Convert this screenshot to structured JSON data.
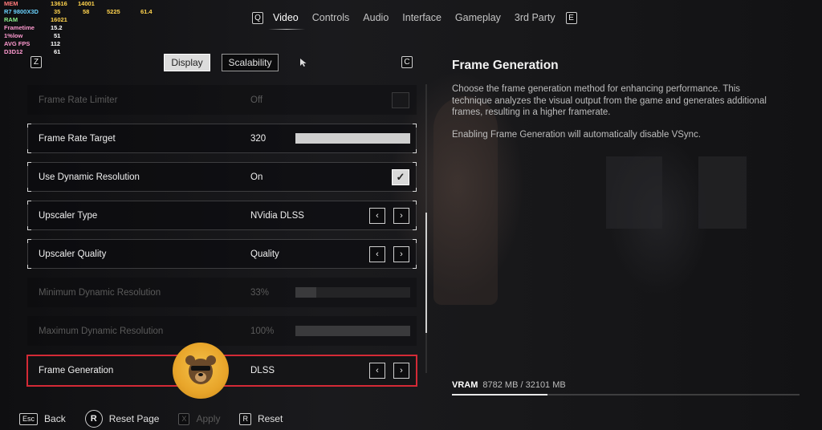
{
  "overlay": {
    "rows": [
      {
        "label": "MEM",
        "values": [
          "13616",
          "14001"
        ]
      },
      {
        "label": "R7 9800X3D",
        "values": [
          "35",
          "58",
          "5225",
          "61.4"
        ]
      },
      {
        "label": "RAM",
        "values": [
          "16021"
        ]
      },
      {
        "label": "Frametime",
        "values": [
          "15.2"
        ]
      },
      {
        "label": "1%low",
        "values": [
          "51"
        ]
      },
      {
        "label": "AVG FPS",
        "values": [
          "112"
        ]
      },
      {
        "label": "D3D12",
        "values": [
          "61"
        ]
      }
    ]
  },
  "topnav": {
    "prev_key": "Q",
    "next_key": "E",
    "tabs": [
      "Video",
      "Controls",
      "Audio",
      "Interface",
      "Gameplay",
      "3rd Party"
    ],
    "active_tab": "Video"
  },
  "subtabs": {
    "prev_key": "Z",
    "next_key": "C",
    "items": [
      "Display",
      "Scalability"
    ],
    "active": "Display"
  },
  "settings": [
    {
      "name": "Frame Rate Limiter",
      "value": "Off",
      "control": "checkbox",
      "checked": false,
      "enabled": false
    },
    {
      "name": "Frame Rate Target",
      "value": "320",
      "control": "slider",
      "level": 1.0,
      "enabled": true
    },
    {
      "name": "Use Dynamic Resolution",
      "value": "On",
      "control": "checkbox",
      "checked": true,
      "enabled": true
    },
    {
      "name": "Upscaler Type",
      "value": "NVidia DLSS",
      "control": "arrows",
      "enabled": true
    },
    {
      "name": "Upscaler Quality",
      "value": "Quality",
      "control": "arrows",
      "enabled": true
    },
    {
      "name": "Minimum Dynamic Resolution",
      "value": "33%",
      "control": "slider",
      "level": 0.18,
      "enabled": false
    },
    {
      "name": "Maximum Dynamic Resolution",
      "value": "100%",
      "control": "slider",
      "level": 1.0,
      "enabled": false
    },
    {
      "name": "Frame Generation",
      "value": "DLSS",
      "control": "arrows",
      "enabled": true,
      "selected": true
    }
  ],
  "info": {
    "title": "Frame Generation",
    "paragraph1": "Choose the frame generation method for enhancing performance. This technique analyzes the visual output from the game and generates additional frames, resulting in a higher framerate.",
    "paragraph2": "Enabling Frame Generation will automatically disable VSync."
  },
  "vram": {
    "label": "VRAM",
    "value": "8782 MB / 32101 MB",
    "used_fraction": 0.274
  },
  "bottom_hints": [
    {
      "key": "Esc",
      "label": "Back",
      "round": false,
      "enabled": true
    },
    {
      "key": "R",
      "label": "Reset Page",
      "round": true,
      "enabled": true
    },
    {
      "key": "X",
      "label": "Apply",
      "round": false,
      "enabled": false
    },
    {
      "key": "R",
      "label": "Reset",
      "round": false,
      "enabled": true
    }
  ],
  "icons": {
    "arrow_left": "‹",
    "arrow_right": "›",
    "check": "✓"
  }
}
